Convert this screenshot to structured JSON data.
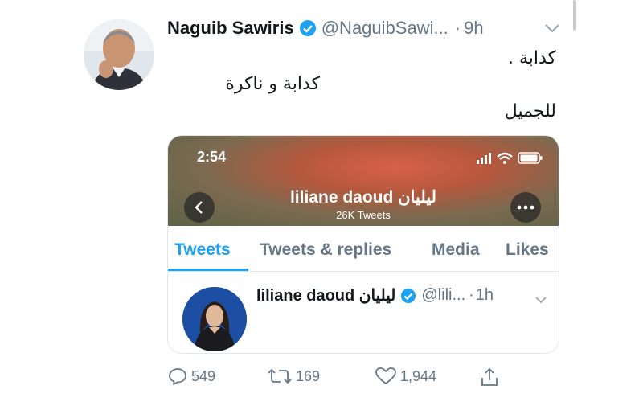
{
  "tweet": {
    "author_name": "Naguib Sawiris",
    "handle": "@NaguibSawi...",
    "separator": "·",
    "time": "9h",
    "lines": [
      "كدابة .",
      "كدابة و ناكرة",
      "للجميل"
    ]
  },
  "quoted_card": {
    "status_time": "2:54",
    "profile_name": "liliane daoud ليليان",
    "tweet_count": "26K Tweets",
    "tabs": [
      "Tweets",
      "Tweets & replies",
      "Media",
      "Likes"
    ],
    "active_tab": "Tweets",
    "inner_tweet": {
      "author_name": "liliane daoud ليليان",
      "handle": "@lili...",
      "separator": "·",
      "time": "1h"
    }
  },
  "actions": {
    "replies": "549",
    "retweets": "169",
    "likes": "1,944"
  },
  "colors": {
    "accent": "#1da1f2",
    "muted": "#657786",
    "text": "#14171a"
  },
  "icons": [
    "verified-badge-icon",
    "chevron-down-icon",
    "back-arrow-icon",
    "more-options-icon",
    "signal-icon",
    "wifi-icon",
    "battery-icon",
    "reply-icon",
    "retweet-icon",
    "like-icon",
    "share-icon"
  ]
}
